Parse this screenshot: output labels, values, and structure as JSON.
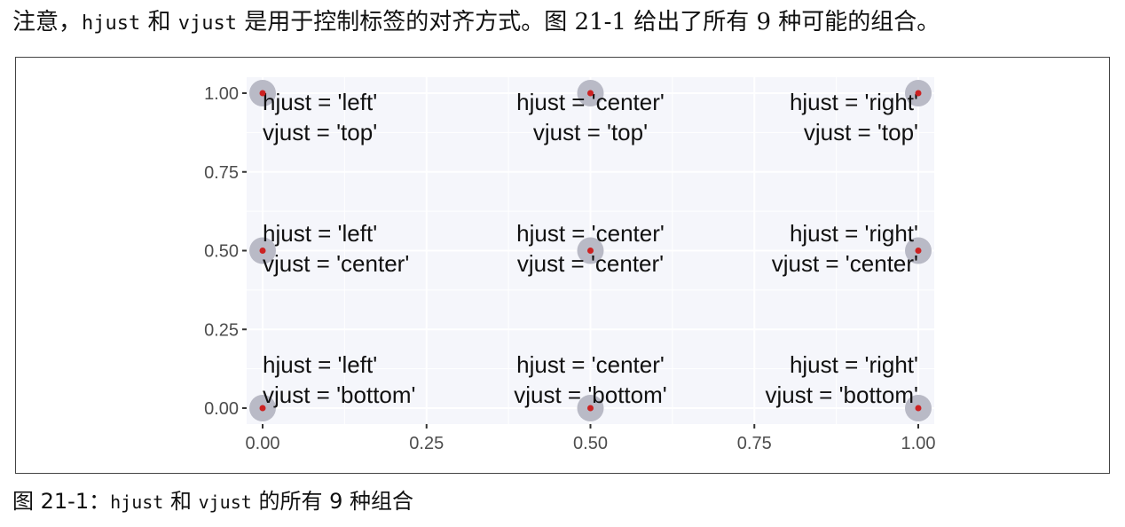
{
  "intro": {
    "part1": "注意，",
    "code1": "hjust",
    "part2": " 和 ",
    "code2": "vjust",
    "part3": " 是用于控制标签的对齐方式。图 21-1 给出了所有 9 种可能的组合。"
  },
  "caption": {
    "part1": "图 21-1：",
    "code1": "hjust",
    "part2": " 和 ",
    "code2": "vjust",
    "part3": " 的所有 9 种组合"
  },
  "colors": {
    "panel": "#f5f6fb",
    "grid": "#ffffff",
    "circle": "#b9bac6",
    "point": "#cc2222",
    "axis_text": "#4d4d4d"
  },
  "chart_data": {
    "type": "scatter",
    "title": "",
    "xlabel": "",
    "ylabel": "",
    "xlim": [
      0,
      1
    ],
    "ylim": [
      0,
      1
    ],
    "xticks": [
      "0.00",
      "0.25",
      "0.50",
      "0.75",
      "1.00"
    ],
    "yticks": [
      "0.00",
      "0.25",
      "0.50",
      "0.75",
      "1.00"
    ],
    "grid": true,
    "points": [
      {
        "x": 0.0,
        "y": 1.0,
        "hjust": "left",
        "vjust": "top",
        "line1": "hjust = 'left'",
        "line2": "vjust = 'top'"
      },
      {
        "x": 0.5,
        "y": 1.0,
        "hjust": "center",
        "vjust": "top",
        "line1": "hjust = 'center'",
        "line2": "vjust = 'top'"
      },
      {
        "x": 1.0,
        "y": 1.0,
        "hjust": "right",
        "vjust": "top",
        "line1": "hjust = 'right'",
        "line2": "vjust = 'top'"
      },
      {
        "x": 0.0,
        "y": 0.5,
        "hjust": "left",
        "vjust": "center",
        "line1": "hjust = 'left'",
        "line2": "vjust = 'center'"
      },
      {
        "x": 0.5,
        "y": 0.5,
        "hjust": "center",
        "vjust": "center",
        "line1": "hjust = 'center'",
        "line2": "vjust = 'center'"
      },
      {
        "x": 1.0,
        "y": 0.5,
        "hjust": "right",
        "vjust": "center",
        "line1": "hjust = 'right'",
        "line2": "vjust = 'center'"
      },
      {
        "x": 0.0,
        "y": 0.0,
        "hjust": "left",
        "vjust": "bottom",
        "line1": "hjust = 'left'",
        "line2": "vjust = 'bottom'"
      },
      {
        "x": 0.5,
        "y": 0.0,
        "hjust": "center",
        "vjust": "bottom",
        "line1": "hjust = 'center'",
        "line2": "vjust = 'bottom'"
      },
      {
        "x": 1.0,
        "y": 0.0,
        "hjust": "right",
        "vjust": "bottom",
        "line1": "hjust = 'right'",
        "line2": "vjust = 'bottom'"
      }
    ]
  }
}
